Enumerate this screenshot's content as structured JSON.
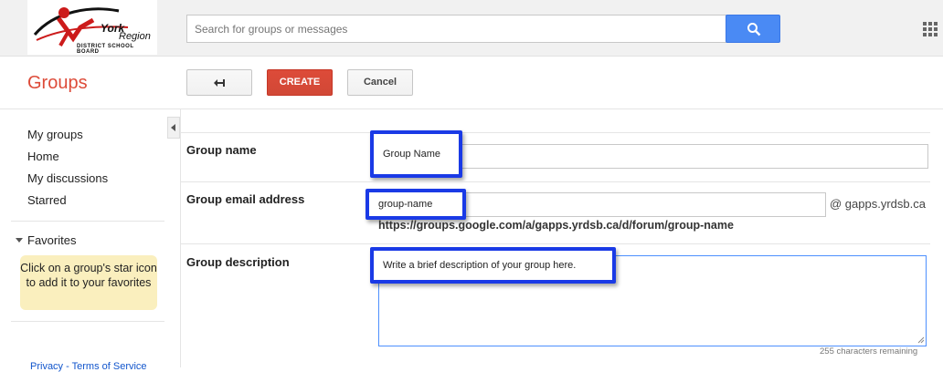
{
  "header": {
    "logo": {
      "line1": "York",
      "line2": "Region",
      "line3": "DISTRICT SCHOOL BOARD"
    },
    "search": {
      "placeholder": "Search for groups or messages",
      "icon": "search-icon"
    },
    "apps_icon": "apps-grid-icon",
    "search_button_color": "#4a8af4"
  },
  "toolbar": {
    "app_title": "Groups",
    "back_icon": "back-arrow-icon",
    "create_label": "CREATE",
    "cancel_label": "Cancel",
    "create_color": "#dd4b39"
  },
  "sidebar": {
    "items": [
      {
        "label": "My groups"
      },
      {
        "label": "Home"
      },
      {
        "label": "My discussions"
      },
      {
        "label": "Starred"
      }
    ],
    "favorites": {
      "label": "Favorites",
      "hint": "Click on a group's star icon to add it to your favorites"
    },
    "footer": "Privacy - Terms of Service"
  },
  "form": {
    "group_name": {
      "label": "Group name",
      "value": "Group Name"
    },
    "group_email": {
      "label": "Group email address",
      "value": "group-name",
      "domain": "@ gapps.yrdsb.ca",
      "url": "https://groups.google.com/a/gapps.yrdsb.ca/d/forum/group-name"
    },
    "group_description": {
      "label": "Group description",
      "value": "Write a brief description of your group here.",
      "remaining": "255 characters remaining"
    },
    "highlight_color": "#1a3ae6"
  }
}
